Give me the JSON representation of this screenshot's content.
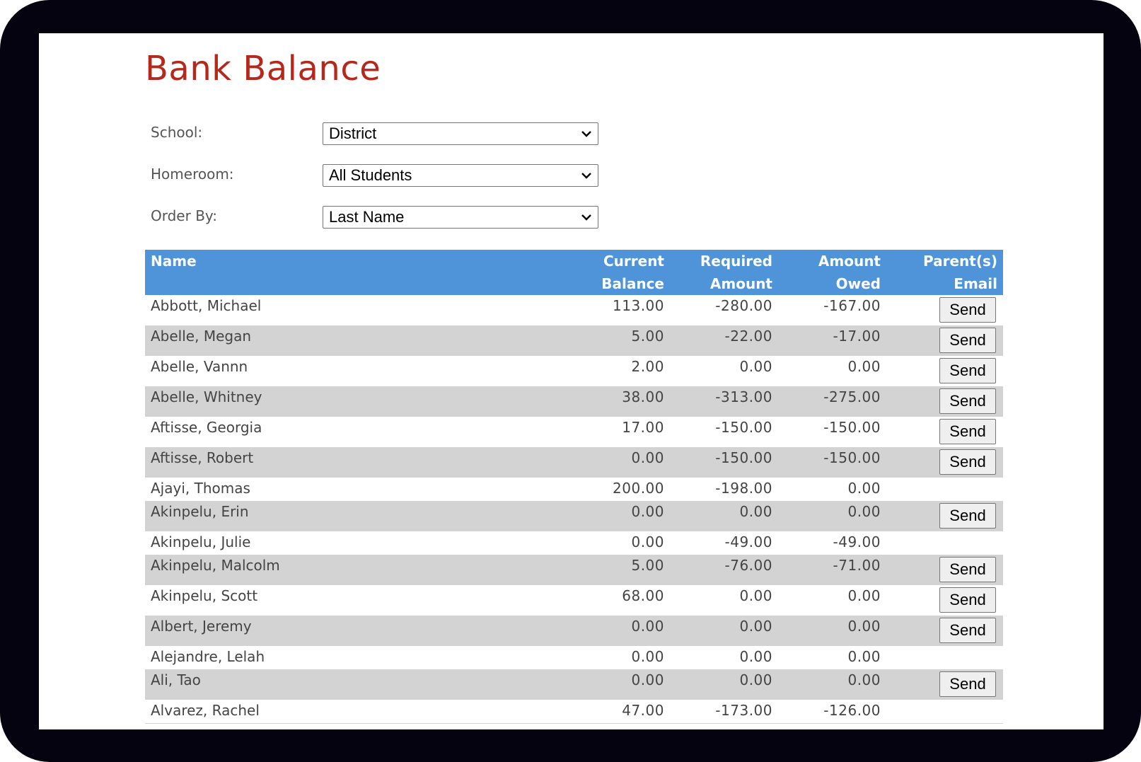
{
  "page": {
    "title": "Bank Balance"
  },
  "filters": {
    "school": {
      "label": "School:",
      "value": "District"
    },
    "homeroom": {
      "label": "Homeroom:",
      "value": "All Students"
    },
    "order_by": {
      "label": "Order By:",
      "value": "Last Name"
    }
  },
  "table": {
    "headers": {
      "name": "Name",
      "current_balance_1": "Current",
      "current_balance_2": "Balance",
      "required_amount_1": "Required",
      "required_amount_2": "Amount",
      "amount_owed_1": "Amount",
      "amount_owed_2": "Owed",
      "parents_email_1": "Parent(s)",
      "parents_email_2": "Email"
    },
    "send_label": "Send",
    "rows": [
      {
        "name": "Abbott, Michael",
        "current": "113.00",
        "required": "-280.00",
        "owed": "-167.00",
        "send": true
      },
      {
        "name": "Abelle, Megan",
        "current": "5.00",
        "required": "-22.00",
        "owed": "-17.00",
        "send": true
      },
      {
        "name": "Abelle, Vannn",
        "current": "2.00",
        "required": "0.00",
        "owed": "0.00",
        "send": true
      },
      {
        "name": "Abelle, Whitney",
        "current": "38.00",
        "required": "-313.00",
        "owed": "-275.00",
        "send": true
      },
      {
        "name": "Aftisse, Georgia",
        "current": "17.00",
        "required": "-150.00",
        "owed": "-150.00",
        "send": true
      },
      {
        "name": "Aftisse, Robert",
        "current": "0.00",
        "required": "-150.00",
        "owed": "-150.00",
        "send": true
      },
      {
        "name": "Ajayi, Thomas",
        "current": "200.00",
        "required": "-198.00",
        "owed": "0.00",
        "send": false
      },
      {
        "name": "Akinpelu, Erin",
        "current": "0.00",
        "required": "0.00",
        "owed": "0.00",
        "send": true
      },
      {
        "name": "Akinpelu, Julie",
        "current": "0.00",
        "required": "-49.00",
        "owed": "-49.00",
        "send": false
      },
      {
        "name": "Akinpelu, Malcolm",
        "current": "5.00",
        "required": "-76.00",
        "owed": "-71.00",
        "send": true
      },
      {
        "name": "Akinpelu, Scott",
        "current": "68.00",
        "required": "0.00",
        "owed": "0.00",
        "send": true
      },
      {
        "name": "Albert, Jeremy",
        "current": "0.00",
        "required": "0.00",
        "owed": "0.00",
        "send": true
      },
      {
        "name": "Alejandre, Lelah",
        "current": "0.00",
        "required": "0.00",
        "owed": "0.00",
        "send": false
      },
      {
        "name": "Ali, Tao",
        "current": "0.00",
        "required": "0.00",
        "owed": "0.00",
        "send": true
      },
      {
        "name": "Alvarez, Rachel",
        "current": "47.00",
        "required": "-173.00",
        "owed": "-126.00",
        "send": false
      }
    ]
  }
}
